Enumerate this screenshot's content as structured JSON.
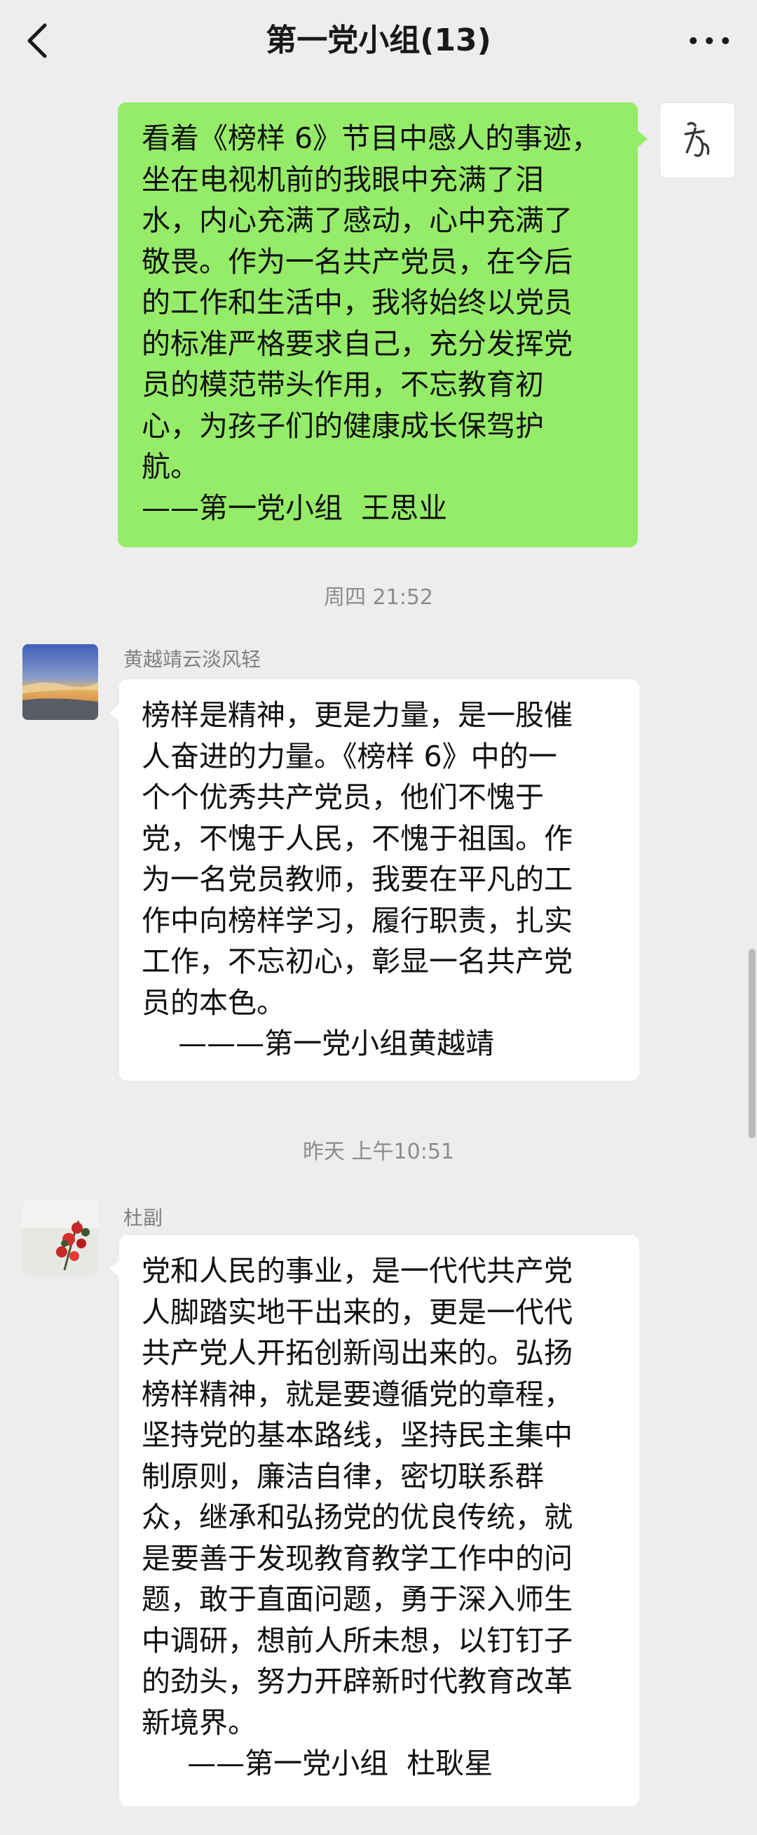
{
  "header": {
    "title": "第一党小组(13)"
  },
  "messages": [
    {
      "direction": "outgoing",
      "text": "看着《榜样 6》节目中感人的事迹，\n坐在电视机前的我眼中充满了泪\n水，内心充满了感动，心中充满了\n敬畏。作为一名共产党员，在今后\n的工作和生活中，我将始终以党员\n的标准严格要求自己，充分发挥党\n员的模范带头作用，不忘教育初\n心，为孩子们的健康成长保驾护\n航。\n——第一党小组  王思业"
    },
    {
      "timestamp": "周四 21:52"
    },
    {
      "direction": "incoming",
      "sender": "黄越靖云淡风轻",
      "text": "榜样是精神，更是力量，是一股催\n人奋进的力量。《榜样 6》中的一\n个个优秀共产党员，他们不愧于\n党，不愧于人民，不愧于祖国。作\n为一名党员教师，我要在平凡的工\n作中向榜样学习，履行职责，扎实\n工作，不忘初心，彰显一名共产党\n员的本色。\n    ———第一党小组黄越靖"
    },
    {
      "timestamp": "昨天 上午10:51"
    },
    {
      "direction": "incoming",
      "sender": "杜副",
      "text": "党和人民的事业，是一代代共产党\n人脚踏实地干出来的，更是一代代\n共产党人开拓创新闯出来的。弘扬\n榜样精神，就是要遵循党的章程，\n坚持党的基本路线，坚持民主集中\n制原则，廉洁自律，密切联系群\n众，继承和弘扬党的优良传统，就\n是要善于发现教育教学工作中的问\n题，敢于直面问题，勇于深入师生\n中调研，想前人所未想，以钉钉子\n的劲头，努力开辟新时代教育改革\n新境界。\n     ——第一党小组  杜耿星"
    }
  ],
  "self_avatar_text": "杏",
  "colors": {
    "background": "#ededed",
    "outgoing_bubble": "#95ec69",
    "incoming_bubble": "#ffffff"
  },
  "icons": {
    "back": "chevron-left-icon",
    "more": "more-dots-icon"
  }
}
